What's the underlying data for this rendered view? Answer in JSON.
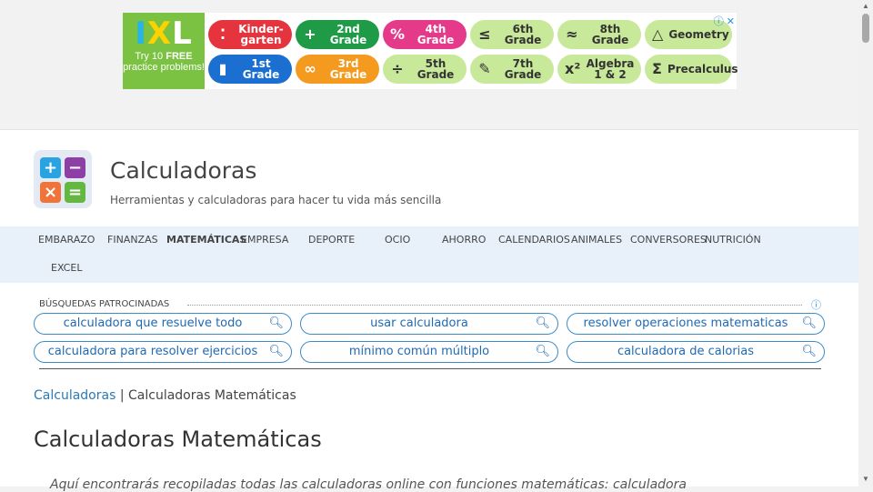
{
  "ad": {
    "logo_letters": [
      "I",
      "X",
      "L"
    ],
    "tagline_pre": "Try 10 ",
    "tagline_bold": "FREE",
    "tagline_post": "practice problems!",
    "adchoices_icon": "info-icon",
    "close_icon": "close-icon",
    "grades": [
      {
        "label": "Kinder- garten",
        "symbol": "dots",
        "color": "#e5343d"
      },
      {
        "label": "2nd Grade",
        "symbol": "plus",
        "color": "#1f9b47"
      },
      {
        "label": "4th Grade",
        "symbol": "percent",
        "color": "#e53a8a"
      },
      {
        "label": "6th Grade",
        "symbol": "less-equal",
        "color": "#c8e89a"
      },
      {
        "label": "8th Grade",
        "symbol": "approx",
        "color": "#c8e89a"
      },
      {
        "label": "Geometry",
        "symbol": "triangle",
        "color": "#c8e89a"
      },
      {
        "label": "1st Grade",
        "symbol": "cup",
        "color": "#1a6fd0"
      },
      {
        "label": "3rd Grade",
        "symbol": "infinity",
        "color": "#f39a1f"
      },
      {
        "label": "5th Grade",
        "symbol": "divide",
        "color": "#c8e89a"
      },
      {
        "label": "7th Grade",
        "symbol": "pencil",
        "color": "#c8e89a"
      },
      {
        "label": "Algebra 1 & 2",
        "symbol": "x-squared",
        "color": "#c8e89a"
      },
      {
        "label": "Precalculus",
        "symbol": "sigma",
        "color": "#c8e89a"
      }
    ]
  },
  "site": {
    "title": "Calculadoras",
    "tagline": "Herramientas y calculadoras para hacer tu vida más sencilla"
  },
  "nav": {
    "items": [
      "EMBARAZO",
      "FINANZAS",
      "MATEMÁTICAS",
      "EMPRESA",
      "DEPORTE",
      "OCIO",
      "AHORRO",
      "CALENDARIOS",
      "ANIMALES",
      "CONVERSORES",
      "NUTRICIÓN",
      "EXCEL"
    ],
    "active": "MATEMÁTICAS"
  },
  "sponsored": {
    "label": "BÚSQUEDAS PATROCINADAS",
    "queries": [
      "calculadora que resuelve todo",
      "usar calculadora",
      "resolver operaciones matematicas",
      "calculadora para resolver ejercicios",
      "mínimo común múltiplo",
      "calculadora de calorias"
    ]
  },
  "breadcrumb": {
    "home": "Calculadoras",
    "separator": " | ",
    "current": "Calculadoras Matemáticas"
  },
  "page": {
    "title": "Calculadoras Matemáticas",
    "intro": "Aquí encontrarás recopiladas todas las calculadoras online con funciones matemáticas: calculadora"
  }
}
